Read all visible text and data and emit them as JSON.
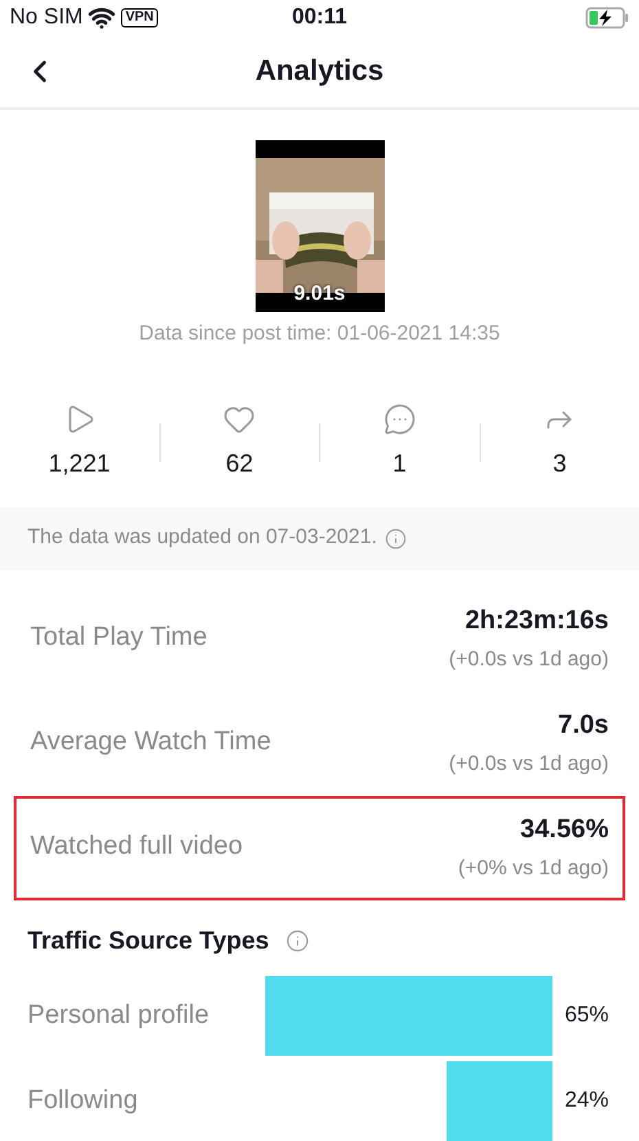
{
  "status_bar": {
    "carrier": "No SIM",
    "vpn": "VPN",
    "time": "00:11"
  },
  "header": {
    "title": "Analytics"
  },
  "video": {
    "duration": "9.01s",
    "post_time": "Data since post time: 01-06-2021 14:35"
  },
  "stats": [
    {
      "kind": "plays",
      "value": "1,221"
    },
    {
      "kind": "likes",
      "value": "62"
    },
    {
      "kind": "comments",
      "value": "1"
    },
    {
      "kind": "shares",
      "value": "3"
    }
  ],
  "notice": "The data was updated on 07-03-2021.",
  "metrics": [
    {
      "label": "Total Play Time",
      "value": "2h:23m:16s",
      "change": "(+0.0s vs 1d ago)",
      "highlighted": false
    },
    {
      "label": "Average Watch Time",
      "value": "7.0s",
      "change": "(+0.0s vs 1d ago)",
      "highlighted": false
    },
    {
      "label": "Watched full video",
      "value": "34.56%",
      "change": "(+0% vs 1d ago)",
      "highlighted": true
    }
  ],
  "traffic": {
    "title": "Traffic Source Types",
    "sources": [
      {
        "label": "Personal profile",
        "percent": "65%"
      },
      {
        "label": "Following",
        "percent": "24%"
      }
    ]
  }
}
